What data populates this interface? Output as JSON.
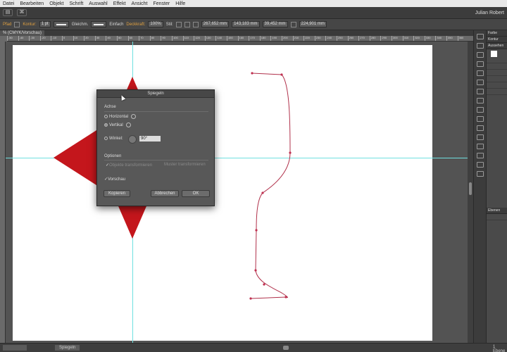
{
  "menubar": {
    "items": [
      "Datei",
      "Bearbeiten",
      "Objekt",
      "Schrift",
      "Auswahl",
      "Effekt",
      "Ansicht",
      "Fenster",
      "Hilfe"
    ]
  },
  "appbar": {
    "user": "Julian Robert"
  },
  "controlbar": {
    "path_label": "Pfad",
    "stroke_label": "Kontur:",
    "stroke_weight": "1 pt",
    "profile": "Gleichm.",
    "brush": "Einfach",
    "opacity_label": "Deckkraft:",
    "opacity_value": "100%",
    "style_label": "Stil:",
    "x_value": "267,652 mm",
    "y_value": "143,183 mm",
    "w_value": "39,452 mm",
    "h_value": "224,901 mm"
  },
  "document": {
    "tab_label": "% (CMYK/Vorschau)"
  },
  "ruler": {
    "h_ticks": [
      "-50",
      "-40",
      "-30",
      "-20",
      "-10",
      "0",
      "10",
      "20",
      "30",
      "40",
      "50",
      "60",
      "70",
      "80",
      "90",
      "100",
      "110",
      "120",
      "130",
      "140",
      "150",
      "160",
      "170",
      "180",
      "190",
      "200",
      "210",
      "220",
      "230",
      "240",
      "250",
      "260",
      "270",
      "280",
      "290",
      "300",
      "310",
      "320",
      "330",
      "340",
      "350",
      "360"
    ]
  },
  "dialog": {
    "title": "Spiegeln",
    "axis_section": "Achse",
    "horizontal_label": "Horizontal",
    "vertical_label": "Vertikal",
    "angle_label": "Winkel:",
    "angle_value": "90°",
    "options_section": "Optionen",
    "transform_objects_label": "Objekte transformieren",
    "transform_patterns_label": "Muster transformieren",
    "preview_label": "Vorschau",
    "copy_button": "Kopieren",
    "cancel_button": "Abbrechen",
    "ok_button": "OK"
  },
  "panels": {
    "color_header": "Farbe",
    "stroke_header": "Kontur",
    "appearance_header": "Aussehen",
    "layers_header": "Ebenen"
  },
  "statusbar": {
    "page_label": "Spiegeln",
    "layers_count": "1 Ebene"
  },
  "colors": {
    "diamond": "#c4161c",
    "path_stroke": "#b0304a",
    "guide": "#6fe0e0",
    "ui_bg": "#535353"
  }
}
